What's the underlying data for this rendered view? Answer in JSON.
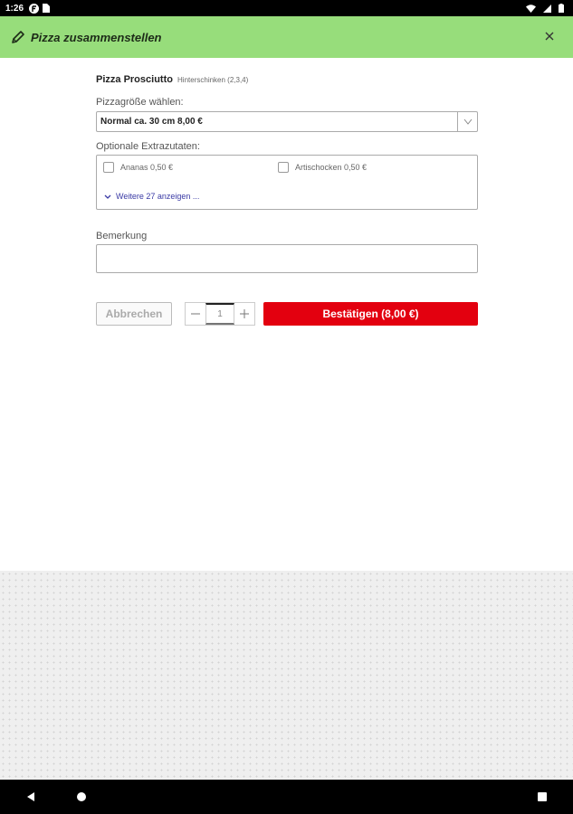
{
  "status_bar": {
    "time": "1:26",
    "icons": [
      "notification-f-icon",
      "sim-icon",
      "wifi-icon",
      "signal-icon",
      "battery-icon"
    ]
  },
  "header": {
    "title": "Pizza zusammenstellen",
    "background": "#97dd7b",
    "icons": [
      "pencil-icon",
      "close-icon"
    ]
  },
  "pizza": {
    "name": "Pizza Prosciutto",
    "description": "Hinterschinken (2,3,4)"
  },
  "size": {
    "label": "Pizzagröße wählen:",
    "selected": "Normal ca. 30 cm 8,00 €"
  },
  "extras": {
    "label": "Optionale Extrazutaten:",
    "items": [
      {
        "label": "Ananas 0,50 €",
        "checked": false
      },
      {
        "label": "Artischocken 0,50 €",
        "checked": false
      }
    ],
    "more_label": "Weitere 27 anzeigen ..."
  },
  "remark": {
    "label": "Bemerkung",
    "value": ""
  },
  "actions": {
    "cancel_label": "Abbrechen",
    "quantity": "1",
    "confirm_label": "Bestätigen (8,00 €)",
    "confirm_color": "#e3000f"
  },
  "nav": {
    "icons": [
      "back-icon",
      "home-icon",
      "recents-icon"
    ]
  }
}
